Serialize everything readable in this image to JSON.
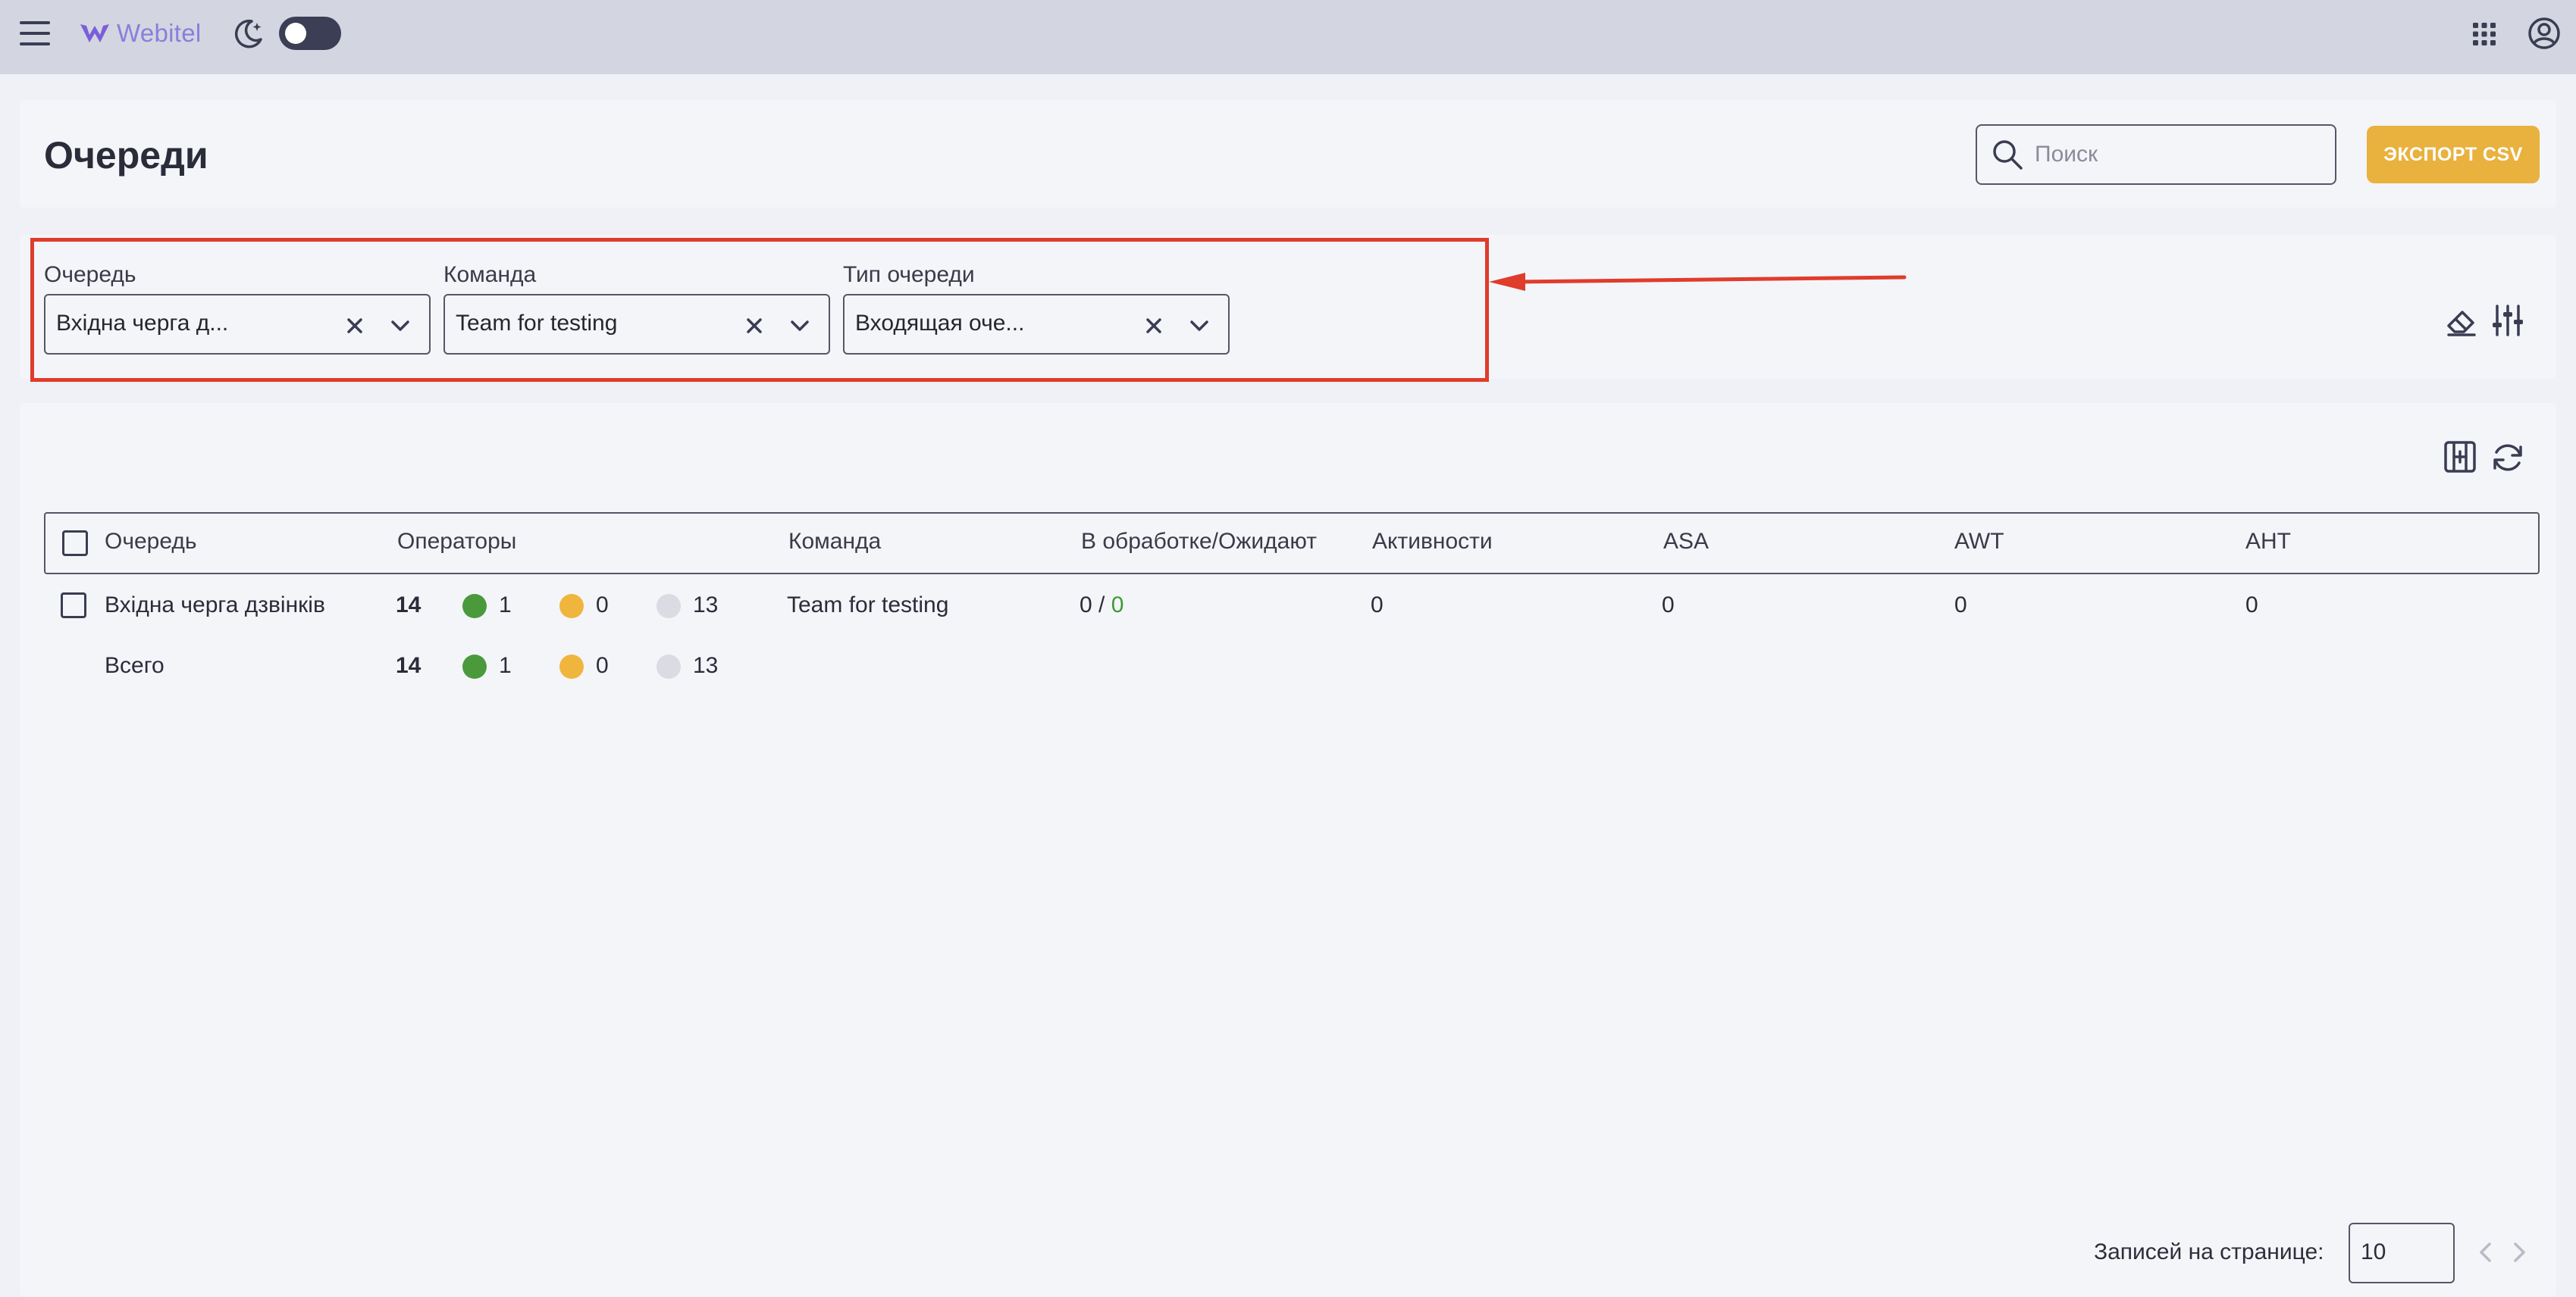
{
  "topbar": {
    "logo_text": "Webitel",
    "icons": [
      "menu-icon",
      "webitel-logo",
      "moon-icon",
      "theme-toggle",
      "apps-grid-icon",
      "user-account-icon"
    ]
  },
  "header": {
    "title": "Очереди",
    "search_placeholder": "Поиск",
    "export_label": "ЭКСПОРТ CSV"
  },
  "filters": [
    {
      "label": "Очередь",
      "value": "Вхідна черга д..."
    },
    {
      "label": "Команда",
      "value": "Team for testing"
    },
    {
      "label": "Тип очереди",
      "value": "Входящая оче..."
    }
  ],
  "table": {
    "columns": [
      "Очередь",
      "Операторы",
      "Команда",
      "В обработке/Ожидают",
      "Активности",
      "ASA",
      "AWT",
      "AHT"
    ],
    "rows": [
      {
        "queue": "Вхідна черга дзвінків",
        "agents_total": "14",
        "agents_online": "1",
        "agents_pause": "0",
        "agents_offline": "13",
        "team": "Team for testing",
        "processing": "0",
        "separator": "/",
        "waiting": "0",
        "activity": "0",
        "asa": "0",
        "awt": "0",
        "aht": "0"
      }
    ],
    "total": {
      "label": "Всего",
      "agents_total": "14",
      "agents_online": "1",
      "agents_pause": "0",
      "agents_offline": "13"
    }
  },
  "pagination": {
    "per_page_label": "Записей на странице:",
    "per_page_value": "10"
  },
  "colors": {
    "topbar": "#d3d5e0",
    "accent": "#e9b13e",
    "online": "#4a9a3c",
    "pause": "#f0b53d",
    "offline": "#dadbe3",
    "highlight": "#e03c2c"
  }
}
